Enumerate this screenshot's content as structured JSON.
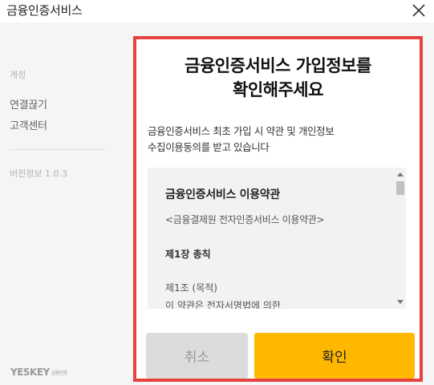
{
  "window": {
    "title": "금융인증서비스",
    "close_icon": "close-icon"
  },
  "sidebar": {
    "section_label": "계정",
    "items": [
      {
        "label": "연결끊기"
      },
      {
        "label": "고객센터"
      }
    ],
    "version": "버전정보 1.0.3",
    "logo": "YESKEY",
    "logo_sub": "금융인증"
  },
  "modal": {
    "title_line1": "금융인증서비스 가입정보를",
    "title_line2": "확인해주세요",
    "desc_line1": "금융인증서비스 최초 가입 시 약관 및 개인정보",
    "desc_line2": "수집이용동의를 받고 있습니다",
    "terms": {
      "heading": "금융인증서비스 이용약관",
      "subtitle": "<금융결제원 전자인증서비스 이용약관>",
      "chapter": "제1장 총칙",
      "article": "제1조 (목적)",
      "body": "이 약관은 전자서명법에 의한"
    },
    "cancel_label": "취소",
    "confirm_label": "확인"
  },
  "colors": {
    "highlight_border": "#e8413e",
    "confirm_bg": "#ffb800",
    "cancel_bg": "#dcdcdc"
  }
}
